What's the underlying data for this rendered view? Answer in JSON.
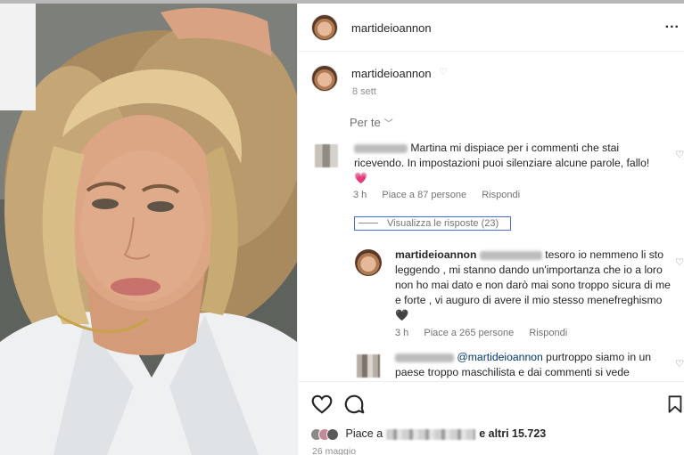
{
  "post": {
    "username": "martideioannon",
    "more_label": "...",
    "caption_username": "martideioannon",
    "caption_time": "8 sett",
    "filter_label": "Per te",
    "colors": {
      "accent_outline": "#4a6ad8",
      "text": "#262626",
      "muted": "#737373",
      "heart_emoji": "#e8578b"
    }
  },
  "comments": [
    {
      "text": "Martina mi dispiace per i commenti che stai ricevendo. In impostazioni puoi silenziare alcune parole, fallo! 💗",
      "time": "3 h",
      "likes": "Piace a 87 persone",
      "reply": "Rispondi",
      "view_replies": "Visualizza le risposte (23)"
    },
    {
      "username": "martideioannon",
      "text_after_mention": "tesoro io nemmeno li sto leggendo , mi stanno dando un'importanza che io a loro non ho mai dato e non darò mai sono troppo sicura di me e forte , vi auguro di avere il mio stesso menefreghismo🖤",
      "time": "3 h",
      "likes": "Piace a 265 persone",
      "reply": "Rispondi"
    },
    {
      "mention": "@martideioannon",
      "text": "purtroppo siamo in un paese troppo maschilista e dai commenti si vede"
    }
  ],
  "footer": {
    "likes_prefix": "Piace a",
    "likes_suffix": "e altri 15.723",
    "date": "26 maggio"
  },
  "icons": [
    "heart-icon",
    "comment-icon",
    "bookmark-icon",
    "more-icon"
  ]
}
